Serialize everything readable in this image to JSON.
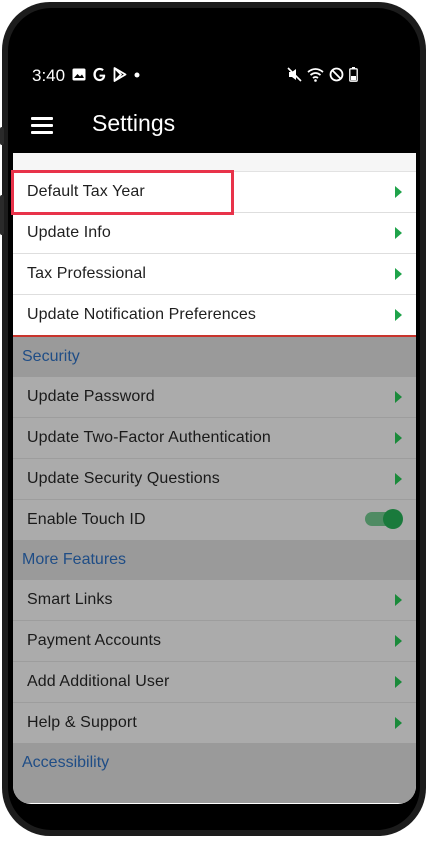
{
  "status_bar": {
    "time": "3:40",
    "left_icons": [
      "image-icon",
      "google-icon",
      "play-store-icon",
      "dot-icon"
    ],
    "right_icons": [
      "mute-icon",
      "wifi-icon",
      "do-not-disturb-icon",
      "battery-icon"
    ]
  },
  "app_bar": {
    "title": "Settings",
    "menu_icon": "menu-icon"
  },
  "account_items": [
    {
      "label": "Default Tax Year"
    },
    {
      "label": "Update Info"
    },
    {
      "label": "Tax Professional"
    },
    {
      "label": "Update Notification Preferences"
    }
  ],
  "security": {
    "heading": "Security",
    "items": [
      {
        "label": "Update Password"
      },
      {
        "label": "Update Two-Factor Authentication"
      },
      {
        "label": "Update Security Questions"
      }
    ],
    "touch_id": {
      "label": "Enable Touch ID",
      "enabled": true
    }
  },
  "more_features": {
    "heading": "More Features",
    "items": [
      {
        "label": "Smart Links"
      },
      {
        "label": "Payment Accounts"
      },
      {
        "label": "Add Additional User"
      },
      {
        "label": "Help & Support"
      }
    ]
  },
  "accessibility": {
    "heading": "Accessibility"
  },
  "colors": {
    "accent_green": "#1fa34a",
    "section_blue": "#1f4d86",
    "highlight_red": "#e8334a",
    "overlay_gray": "#ababab"
  }
}
